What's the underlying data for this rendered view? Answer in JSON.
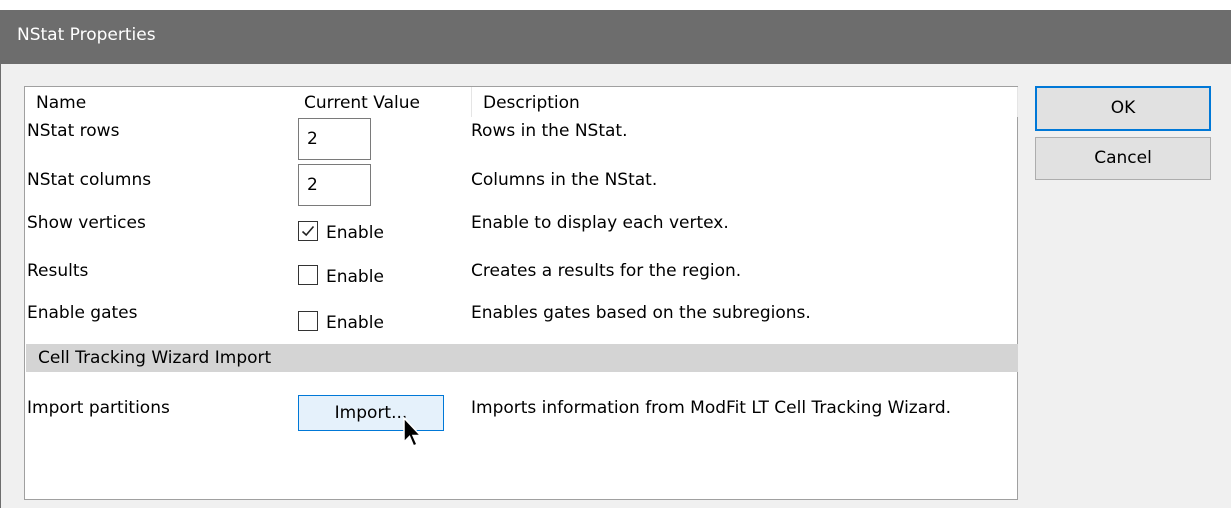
{
  "window": {
    "title": "NStat Properties"
  },
  "grid": {
    "headers": {
      "name": "Name",
      "value": "Current Value",
      "description": "Description"
    },
    "rows": [
      {
        "name": "NStat rows",
        "value": "2",
        "description": "Rows in the NStat."
      },
      {
        "name": "NStat columns",
        "value": "2",
        "description": "Columns in the NStat."
      },
      {
        "name": "Show vertices",
        "checked": true,
        "value_label": "Enable",
        "description": "Enable to display each vertex."
      },
      {
        "name": "Results",
        "checked": false,
        "value_label": "Enable",
        "description": "Creates a results for the region."
      },
      {
        "name": "Enable gates",
        "checked": false,
        "value_label": "Enable",
        "description": "Enables gates based on the subregions."
      }
    ],
    "section": "Cell Tracking Wizard Import",
    "import_row": {
      "name": "Import partitions",
      "button": "Import...",
      "description": "Imports information from ModFit LT Cell Tracking Wizard."
    }
  },
  "buttons": {
    "ok": "OK",
    "cancel": "Cancel"
  },
  "colors": {
    "titlebar": "#6d6d6d",
    "focus": "#0078d7",
    "section": "#d4d4d4"
  }
}
